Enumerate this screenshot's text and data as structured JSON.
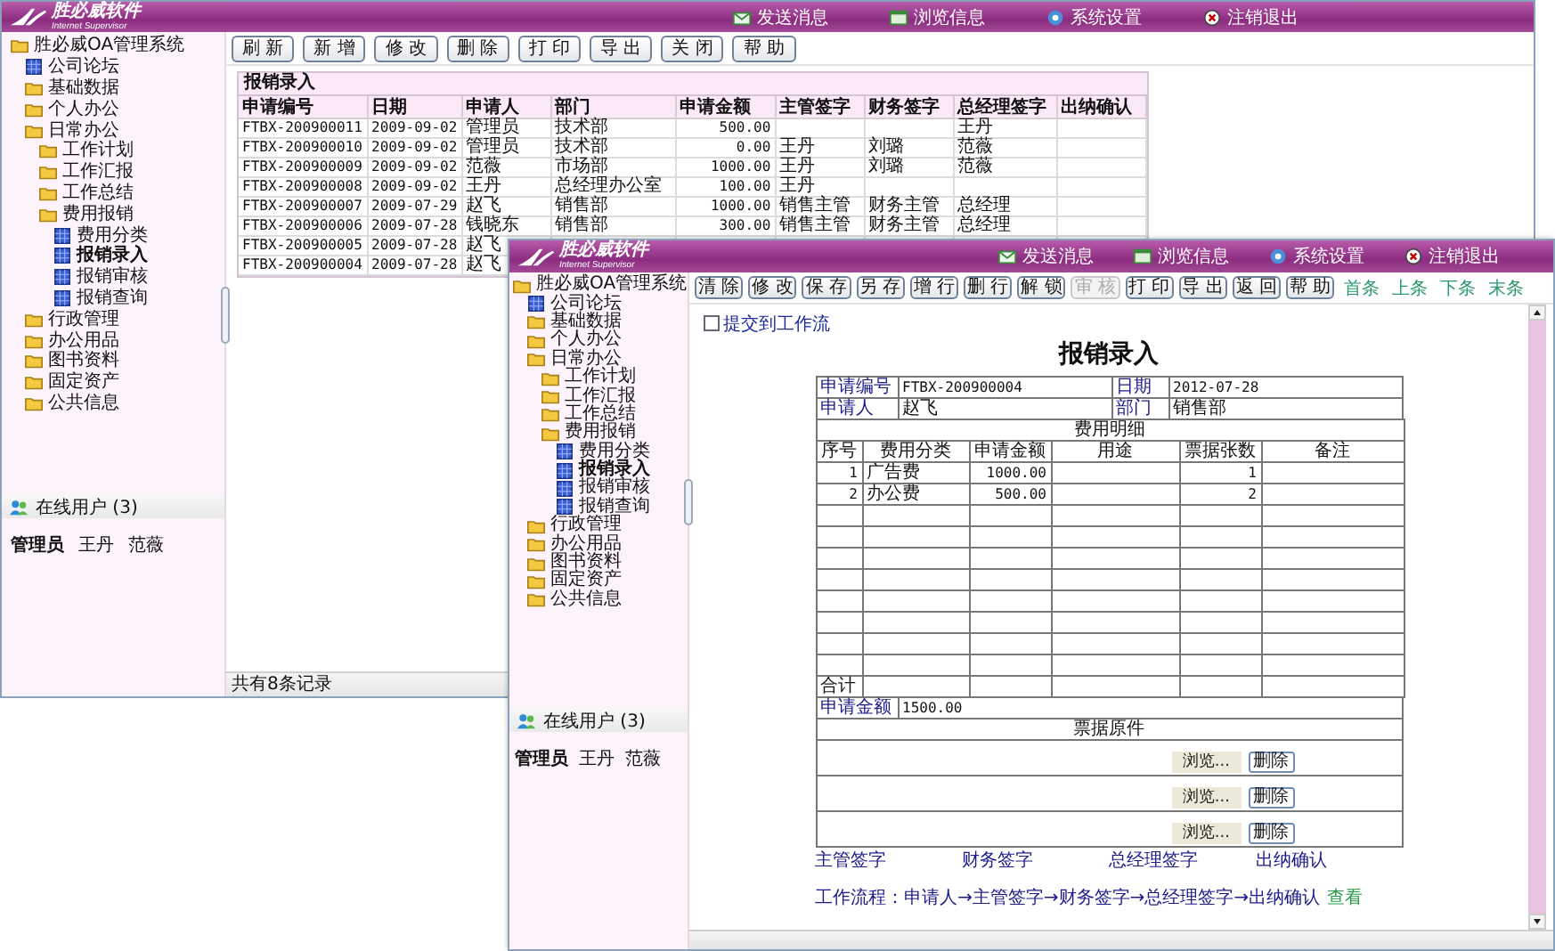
{
  "main_window": {
    "logo": {
      "name": "胜必威软件",
      "subtitle": "Internet Supervisor"
    },
    "header_links": [
      "发送消息",
      "浏览信息",
      "系统设置",
      "注销退出"
    ],
    "toolbar": [
      "刷 新",
      "新 增",
      "修 改",
      "删 除",
      "打 印",
      "导 出",
      "关 闭",
      "帮 助"
    ],
    "tree": [
      {
        "label": "胜必威OA管理系统",
        "kind": "folder",
        "selected": false,
        "children": [
          {
            "label": "公司论坛",
            "kind": "page",
            "selected": false
          },
          {
            "label": "基础数据",
            "kind": "folder",
            "selected": false
          },
          {
            "label": "个人办公",
            "kind": "folder",
            "selected": false
          },
          {
            "label": "日常办公",
            "kind": "folder",
            "selected": false,
            "children": [
              {
                "label": "工作计划",
                "kind": "folder",
                "selected": false
              },
              {
                "label": "工作汇报",
                "kind": "folder",
                "selected": false
              },
              {
                "label": "工作总结",
                "kind": "folder",
                "selected": false
              },
              {
                "label": "费用报销",
                "kind": "folder",
                "selected": false,
                "children": [
                  {
                    "label": "费用分类",
                    "kind": "page",
                    "selected": false
                  },
                  {
                    "label": "报销录入",
                    "kind": "page",
                    "selected": true
                  },
                  {
                    "label": "报销审核",
                    "kind": "page",
                    "selected": false
                  },
                  {
                    "label": "报销查询",
                    "kind": "page",
                    "selected": false
                  }
                ]
              }
            ]
          },
          {
            "label": "行政管理",
            "kind": "folder",
            "selected": false
          },
          {
            "label": "办公用品",
            "kind": "folder",
            "selected": false
          },
          {
            "label": "图书资料",
            "kind": "folder",
            "selected": false
          },
          {
            "label": "固定资产",
            "kind": "folder",
            "selected": false
          },
          {
            "label": "公共信息",
            "kind": "folder",
            "selected": false
          }
        ]
      }
    ],
    "online_users": {
      "title": "在线用户 (3)",
      "users": [
        {
          "name": "管理员",
          "current": true
        },
        {
          "name": "王丹",
          "current": false
        },
        {
          "name": "范薇",
          "current": false
        }
      ]
    },
    "table": {
      "title": "报销录入",
      "columns": [
        "申请编号",
        "日期",
        "申请人",
        "部门",
        "申请金额",
        "主管签字",
        "财务签字",
        "总经理签字",
        "出纳确认"
      ],
      "rows": [
        [
          "FTBX-200900011",
          "2009-09-02",
          "管理员",
          "技术部",
          "500.00",
          "",
          "",
          "王丹"
        ],
        [
          "FTBX-200900010",
          "2009-09-02",
          "管理员",
          "技术部",
          "0.00",
          "王丹",
          "刘璐",
          "范薇"
        ],
        [
          "FTBX-200900009",
          "2009-09-02",
          "范薇",
          "市场部",
          "1000.00",
          "王丹",
          "刘璐",
          "范薇"
        ],
        [
          "FTBX-200900008",
          "2009-09-02",
          "王丹",
          "总经理办公室",
          "100.00",
          "王丹"
        ],
        [
          "FTBX-200900007",
          "2009-07-29",
          "赵飞",
          "销售部",
          "1000.00",
          "销售主管",
          "财务主管",
          "总经理"
        ],
        [
          "FTBX-200900006",
          "2009-07-28",
          "钱晓东",
          "销售部",
          "300.00",
          "销售主管",
          "财务主管",
          "总经理"
        ],
        [
          "FTBX-200900005",
          "2009-07-28",
          "赵飞"
        ],
        [
          "FTBX-200900004",
          "2009-07-28",
          "赵飞"
        ]
      ]
    },
    "status": "共有8条记录"
  },
  "form_window": {
    "logo": {
      "name": "胜必威软件",
      "subtitle": "Internet Supervisor"
    },
    "header_links": [
      "发送消息",
      "浏览信息",
      "系统设置",
      "注销退出"
    ],
    "toolbar": [
      {
        "label": "清 除",
        "disabled": false
      },
      {
        "label": "修 改",
        "disabled": false
      },
      {
        "label": "保 存",
        "disabled": false
      },
      {
        "label": "另 存",
        "disabled": false
      },
      {
        "label": "增 行",
        "disabled": false
      },
      {
        "label": "删 行",
        "disabled": false
      },
      {
        "label": "解 锁",
        "disabled": false
      },
      {
        "label": "审 核",
        "disabled": true
      },
      {
        "label": "打 印",
        "disabled": false
      },
      {
        "label": "导 出",
        "disabled": false
      },
      {
        "label": "返 回",
        "disabled": false
      },
      {
        "label": "帮 助",
        "disabled": false
      }
    ],
    "nav_links": [
      "首条",
      "上条",
      "下条",
      "末条"
    ],
    "tree": [
      {
        "label": "胜必威OA管理系统",
        "kind": "folder",
        "selected": false,
        "children": [
          {
            "label": "公司论坛",
            "kind": "page",
            "selected": false
          },
          {
            "label": "基础数据",
            "kind": "folder",
            "selected": false
          },
          {
            "label": "个人办公",
            "kind": "folder",
            "selected": false
          },
          {
            "label": "日常办公",
            "kind": "folder",
            "selected": false,
            "children": [
              {
                "label": "工作计划",
                "kind": "folder",
                "selected": false
              },
              {
                "label": "工作汇报",
                "kind": "folder",
                "selected": false
              },
              {
                "label": "工作总结",
                "kind": "folder",
                "selected": false
              },
              {
                "label": "费用报销",
                "kind": "folder",
                "selected": false,
                "children": [
                  {
                    "label": "费用分类",
                    "kind": "page",
                    "selected": false
                  },
                  {
                    "label": "报销录入",
                    "kind": "page",
                    "selected": true
                  },
                  {
                    "label": "报销审核",
                    "kind": "page",
                    "selected": false
                  },
                  {
                    "label": "报销查询",
                    "kind": "page",
                    "selected": false
                  }
                ]
              }
            ]
          },
          {
            "label": "行政管理",
            "kind": "folder",
            "selected": false
          },
          {
            "label": "办公用品",
            "kind": "folder",
            "selected": false
          },
          {
            "label": "图书资料",
            "kind": "folder",
            "selected": false
          },
          {
            "label": "固定资产",
            "kind": "folder",
            "selected": false
          },
          {
            "label": "公共信息",
            "kind": "folder",
            "selected": false
          }
        ]
      }
    ],
    "online_users": {
      "title": "在线用户 (3)",
      "users": [
        {
          "name": "管理员",
          "current": true
        },
        {
          "name": "王丹",
          "current": false
        },
        {
          "name": "范薇",
          "current": false
        }
      ]
    },
    "submit_checkbox": {
      "label": "提交到工作流",
      "checked": false
    },
    "form": {
      "title": "报销录入",
      "fields": [
        {
          "label": "申请编号",
          "value": "FTBX-200900004"
        },
        {
          "label": "日期",
          "value": "2012-07-28"
        },
        {
          "label": "申请人",
          "value": "赵飞"
        },
        {
          "label": "部门",
          "value": "销售部"
        }
      ],
      "details_title": "费用明细",
      "columns": [
        "序号",
        "费用分类",
        "申请金额",
        "用途",
        "票据张数",
        "备注"
      ],
      "rows": [
        [
          "1",
          "广告费",
          "1000.00",
          "",
          "1"
        ],
        [
          "2",
          "办公费",
          "500.00",
          "",
          "2"
        ]
      ],
      "total_label": "合计",
      "amount_label": "申请金额",
      "amount": "1500.00",
      "attachments_title": "票据原件",
      "attachments": [
        {
          "browse": "浏览...",
          "delete": "删除"
        },
        {
          "browse": "浏览...",
          "delete": "删除"
        },
        {
          "browse": "浏览...",
          "delete": "删除"
        }
      ],
      "signatures": [
        "主管签字",
        "财务签字",
        "总经理签字",
        "出纳确认"
      ],
      "workflow": "工作流程：申请人→主管签字→财务签字→总经理签字→出纳确认",
      "workflow_link": "查看"
    }
  }
}
